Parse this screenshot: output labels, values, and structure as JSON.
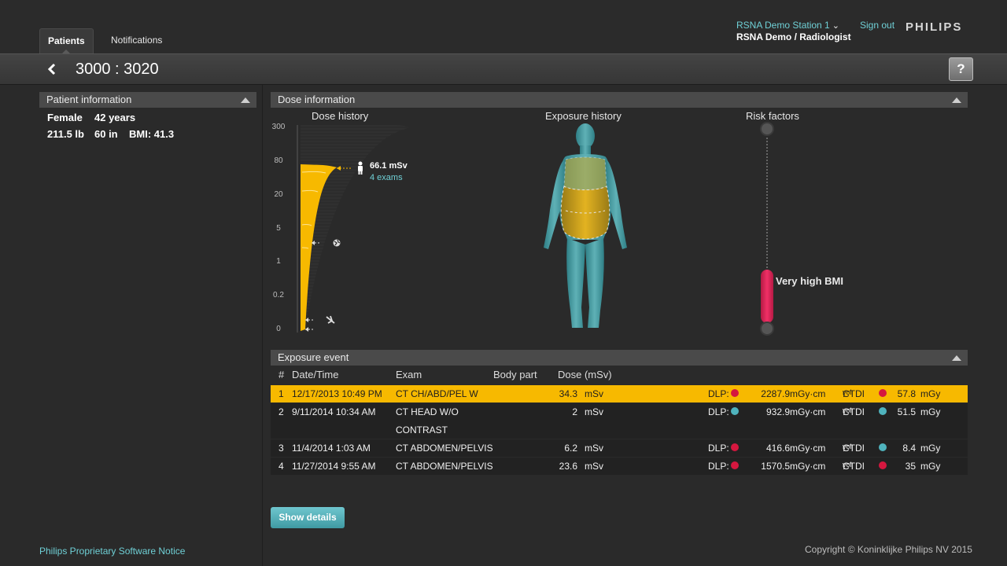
{
  "tabs": [
    {
      "label": "Patients",
      "active": true
    },
    {
      "label": "Notifications",
      "active": false
    }
  ],
  "user": {
    "station": "RSNA Demo Station 1",
    "role": "RSNA Demo / Radiologist",
    "sign_out": "Sign out",
    "brand": "PHILIPS"
  },
  "page": {
    "id": "3000 : 3020",
    "help": "?"
  },
  "patient_info": {
    "title": "Patient information",
    "sex": "Female",
    "age": "42 years",
    "weight": "211.5 lb",
    "height": "60 in",
    "bmi": "BMI: 41.3"
  },
  "dose_info": {
    "title": "Dose information",
    "dose_history_title": "Dose history",
    "exposure_history_title": "Exposure history",
    "risk_factors_title": "Risk factors",
    "axis_ticks": [
      "300",
      "80",
      "20",
      "5",
      "1",
      "0.2",
      "0"
    ],
    "total_dose": "66.1 mSv",
    "total_exams": "4 exams",
    "risk_label": "Very high BMI"
  },
  "exposure_event": {
    "title": "Exposure event",
    "columns": [
      "#",
      "Date/Time",
      "Exam",
      "Body part",
      "Dose (mSv)"
    ],
    "rows": [
      {
        "num": "1",
        "datetime": "12/17/2013 10:49 PM",
        "exam": "CT CH/ABD/PEL W",
        "exam2": "",
        "dose": "34.3",
        "dose_unit": "mSv",
        "dlp_label": "DLP:",
        "dlp_color": "#d5173f",
        "dlp": "2287.9",
        "dlp_unit": "mGy·cm",
        "ctdi_label": "CTDI",
        "ctdi_sub": "vol",
        "ctdi_colon": ":",
        "ctdi_color": "#d5173f",
        "ctdi": "57.8",
        "ctdi_unit": "mGy",
        "selected": true
      },
      {
        "num": "2",
        "datetime": "9/11/2014 10:34 AM",
        "exam": "CT HEAD W/O",
        "exam2": "CONTRAST",
        "dose": "2",
        "dose_unit": "mSv",
        "dlp_label": "DLP:",
        "dlp_color": "#4fb3bd",
        "dlp": "932.9",
        "dlp_unit": "mGy·cm",
        "ctdi_label": "CTDI",
        "ctdi_sub": "vol",
        "ctdi_colon": ":",
        "ctdi_color": "#4fb3bd",
        "ctdi": "51.5",
        "ctdi_unit": "mGy",
        "selected": false
      },
      {
        "num": "3",
        "datetime": "11/4/2014 1:03 AM",
        "exam": "CT ABDOMEN/PELVIS",
        "exam2": "",
        "dose": "6.2",
        "dose_unit": "mSv",
        "dlp_label": "DLP:",
        "dlp_color": "#d5173f",
        "dlp": "416.6",
        "dlp_unit": "mGy·cm",
        "ctdi_label": "CTDI",
        "ctdi_sub": "vol",
        "ctdi_colon": ":",
        "ctdi_color": "#4fb3bd",
        "ctdi": "8.4",
        "ctdi_unit": "mGy",
        "selected": false
      },
      {
        "num": "4",
        "datetime": "11/27/2014 9:55 AM",
        "exam": "CT ABDOMEN/PELVIS",
        "exam2": "",
        "dose": "23.6",
        "dose_unit": "mSv",
        "dlp_label": "DLP:",
        "dlp_color": "#d5173f",
        "dlp": "1570.5",
        "dlp_unit": "mGy·cm",
        "ctdi_label": "CTDI",
        "ctdi_sub": "vol",
        "ctdi_colon": ":",
        "ctdi_color": "#d5173f",
        "ctdi": "35",
        "ctdi_unit": "mGy",
        "selected": false
      }
    ]
  },
  "buttons": {
    "show_details": "Show details"
  },
  "footer": {
    "notice": "Philips Proprietary Software Notice",
    "copyright": "Copyright © Koninklijke Philips NV 2015"
  },
  "colors": {
    "accent": "#6fd0d6",
    "selected_row": "#f7b900",
    "risk": "#e8285a"
  }
}
